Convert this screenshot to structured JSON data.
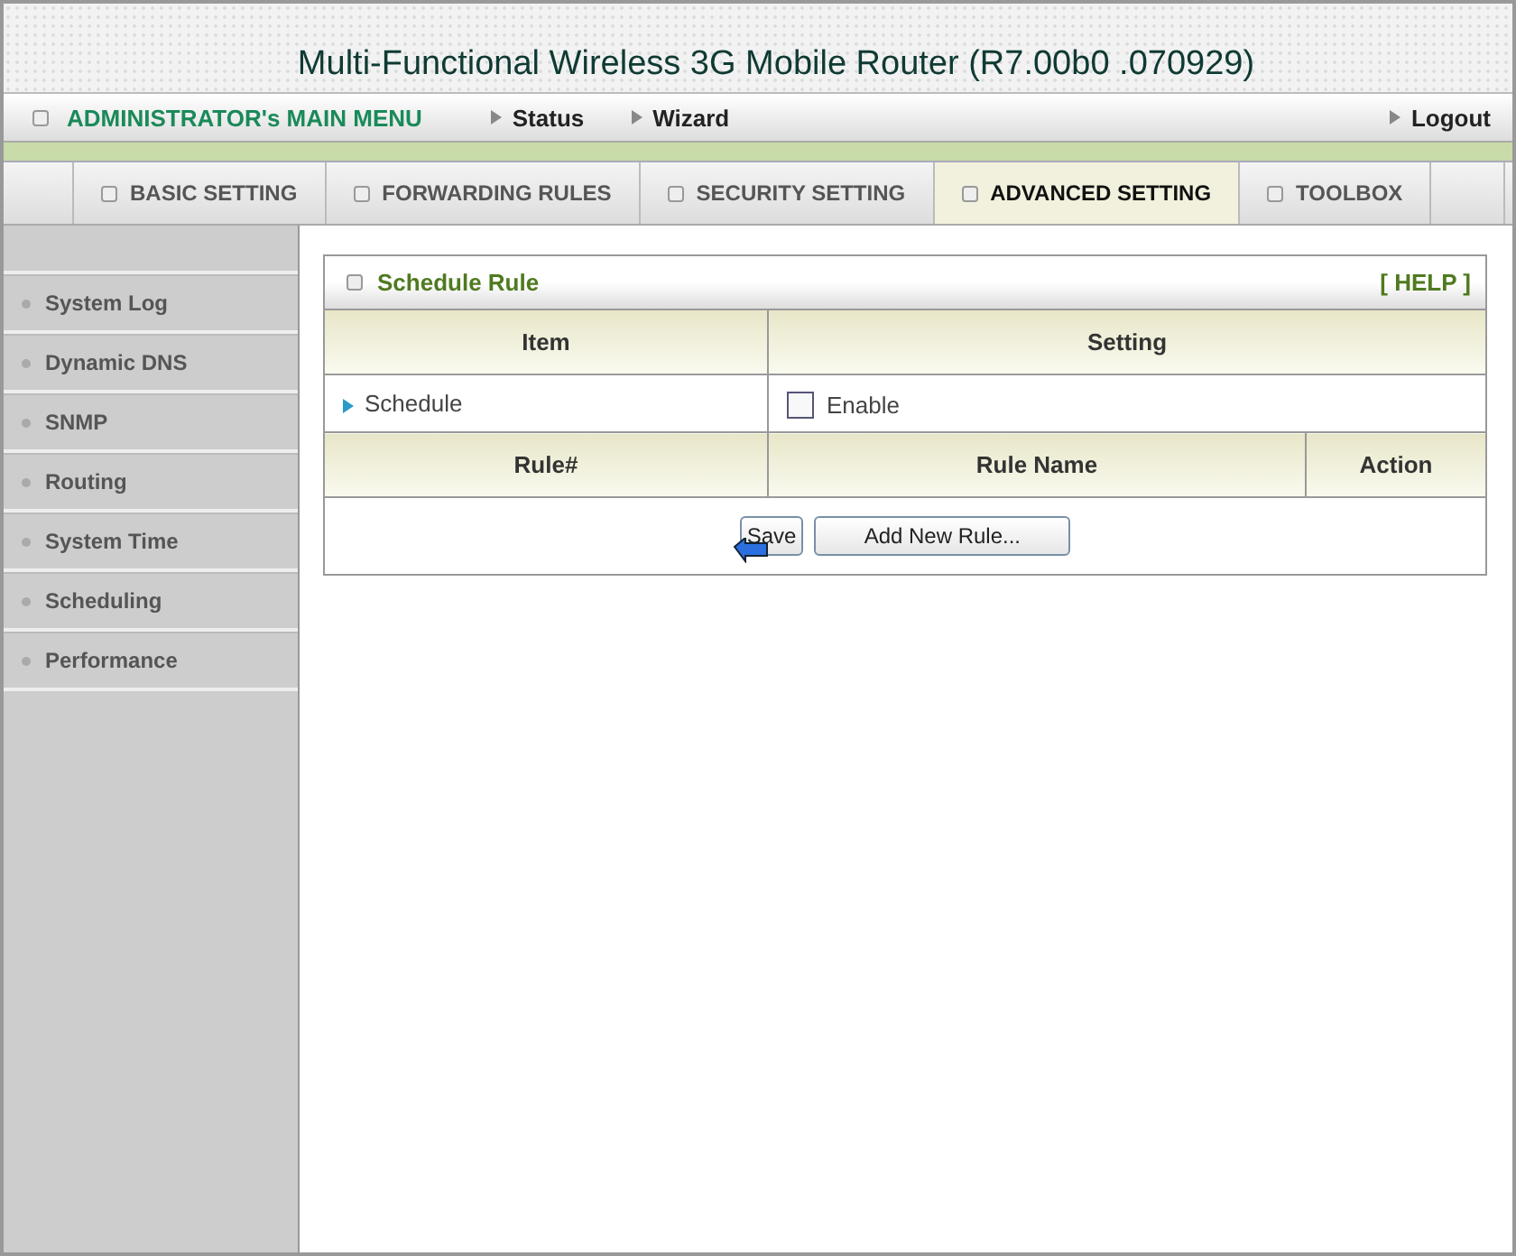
{
  "header": {
    "title": "Multi-Functional Wireless 3G Mobile Router (R7.00b0 .070929)"
  },
  "main_menu": {
    "label": "ADMINISTRATOR's MAIN MENU",
    "links": [
      {
        "label": "Status"
      },
      {
        "label": "Wizard"
      }
    ],
    "logout": "Logout"
  },
  "tabs": [
    {
      "label": "BASIC SETTING",
      "selected": false
    },
    {
      "label": "FORWARDING RULES",
      "selected": false
    },
    {
      "label": "SECURITY SETTING",
      "selected": false
    },
    {
      "label": "ADVANCED SETTING",
      "selected": true
    },
    {
      "label": "TOOLBOX",
      "selected": false
    }
  ],
  "sidebar": {
    "items": [
      {
        "label": "System Log"
      },
      {
        "label": "Dynamic DNS"
      },
      {
        "label": "SNMP"
      },
      {
        "label": "Routing"
      },
      {
        "label": "System Time"
      },
      {
        "label": "Scheduling"
      },
      {
        "label": "Performance"
      }
    ]
  },
  "panel": {
    "title": "Schedule Rule",
    "help": "[ HELP ]",
    "settings_columns": [
      "Item",
      "Setting"
    ],
    "settings_rows": [
      {
        "item": "Schedule",
        "checkbox_label": "Enable",
        "checked": false
      }
    ],
    "rules_columns": [
      "Rule#",
      "Rule Name",
      "Action"
    ],
    "buttons": [
      "Save",
      "Add New Rule..."
    ]
  }
}
